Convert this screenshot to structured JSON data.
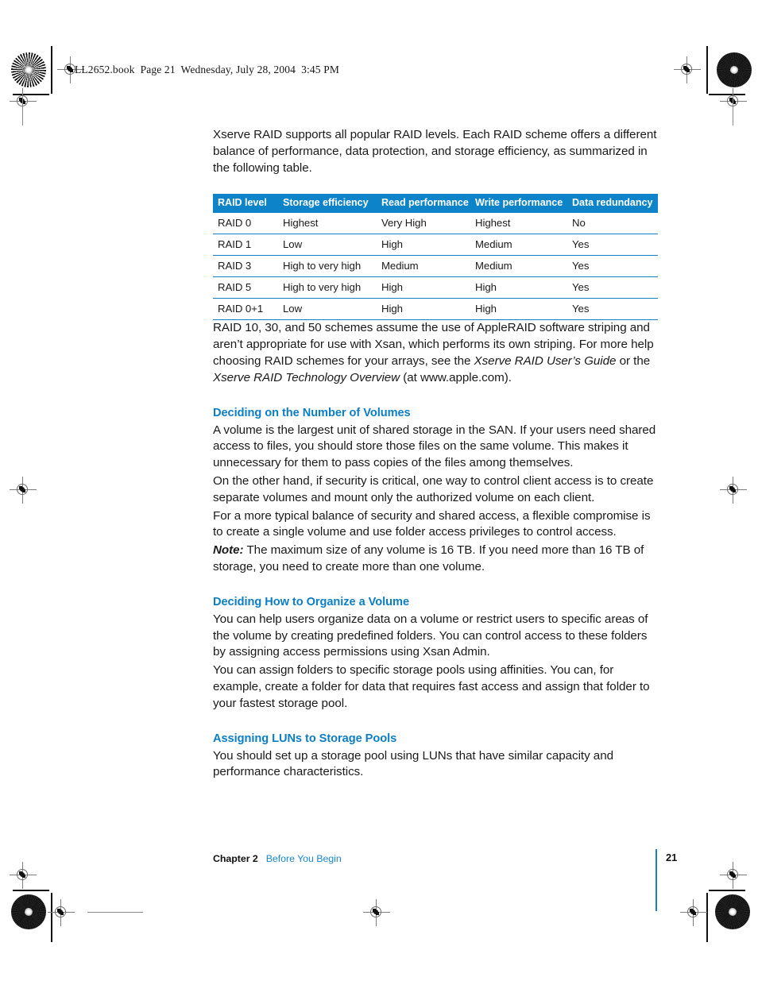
{
  "running_header": "LL2652.book  Page 21  Wednesday, July 28, 2004  3:45 PM",
  "intro": {
    "paragraph": "Xserve RAID supports all popular RAID levels. Each RAID scheme offers a different balance of performance, data protection, and storage efficiency, as summarized in the following table."
  },
  "raid_table": {
    "headers": [
      "RAID level",
      "Storage efficiency",
      "Read performance",
      "Write performance",
      "Data redundancy"
    ],
    "rows": [
      [
        "RAID 0",
        "Highest",
        "Very High",
        "Highest",
        "No"
      ],
      [
        "RAID 1",
        "Low",
        "High",
        "Medium",
        "Yes"
      ],
      [
        "RAID 3",
        "High to very high",
        "Medium",
        "Medium",
        "Yes"
      ],
      [
        "RAID 5",
        "High to very high",
        "High",
        "High",
        "Yes"
      ],
      [
        "RAID 0+1",
        "Low",
        "High",
        "High",
        "Yes"
      ]
    ],
    "header_bg": "#0d84ca",
    "rule_color": "#1481c4"
  },
  "after_table": {
    "part1": "RAID 10, 30, and 50 schemes assume the use of AppleRAID software striping and aren’t appropriate for use with Xsan, which performs its own striping. For more help choosing RAID schemes for your arrays, see the ",
    "italic1": "Xserve RAID User’s Guide",
    "part2": " or the ",
    "italic2": "Xserve RAID Technology Overview",
    "part3": " (at www.apple.com)."
  },
  "sections": [
    {
      "heading": "Deciding on the Number of Volumes",
      "paragraphs": [
        "A volume is the largest unit of shared storage in the SAN. If your users need shared access to files, you should store those files on the same volume. This makes it unnecessary for them to pass copies of the files among themselves.",
        "On the other hand, if security is critical, one way to control client access is to create separate volumes and mount only the authorized volume on each client.",
        "For a more typical balance of security and shared access, a flexible compromise is to create a single volume and use folder access privileges to control access."
      ],
      "note_label": "Note:",
      "note_text": " The maximum size of any volume is 16 TB. If you need more than 16 TB of storage, you need to create more than one volume."
    },
    {
      "heading": "Deciding How to Organize a Volume",
      "paragraphs": [
        "You can help users organize data on a volume or restrict users to specific areas of the volume by creating predefined folders. You can control access to these folders by assigning access permissions using Xsan Admin.",
        "You can assign folders to specific storage pools using affinities. You can, for example, create a folder for data that requires fast access and assign that folder to your fastest storage pool."
      ]
    },
    {
      "heading": "Assigning LUNs to Storage Pools",
      "paragraphs": [
        "You should set up a storage pool using LUNs that have similar capacity and performance characteristics."
      ]
    }
  ],
  "footer": {
    "chapter": "Chapter 2",
    "chapter_title": "Before You Begin",
    "page_number": "21",
    "accent_color": "#1b7fc4"
  },
  "heading_color": "#0c7ec4"
}
